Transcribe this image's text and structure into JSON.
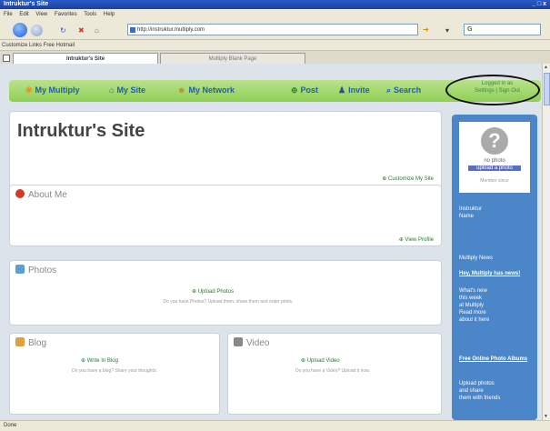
{
  "window": {
    "title": "Intruktur's Site",
    "controls": "_ □ x"
  },
  "menu": {
    "items": [
      "File",
      "Edit",
      "View",
      "Favorites",
      "Tools",
      "Help"
    ]
  },
  "toolbar": {
    "address": "http://instruktur.multiply.com",
    "search_value": "G"
  },
  "links_bar": {
    "text": "Customize Links   Free Hotmail"
  },
  "tabs": [
    {
      "label": "Intruktur's Site"
    },
    {
      "label": "Multiply Blank Page"
    }
  ],
  "global_nav": {
    "items": [
      {
        "label": "My Multiply",
        "icon": "multiply-icon"
      },
      {
        "label": "My Site",
        "icon": "home-icon"
      },
      {
        "label": "My Network",
        "icon": "network-icon"
      },
      {
        "label": "Post",
        "icon": "post-icon"
      },
      {
        "label": "Invite",
        "icon": "invite-icon"
      },
      {
        "label": "Search",
        "icon": "search-icon"
      }
    ],
    "signin_line1": "Logged in as",
    "signin_line2": "Settings | Sign Out"
  },
  "site": {
    "title": "Intruktur's Site",
    "customize_label": "Customize My Site"
  },
  "sections": {
    "about": {
      "title": "About Me",
      "link": "View Profile"
    },
    "photos": {
      "title": "Photos",
      "link": "Upload Photos",
      "hint": "Do you have Photos? Upload them, share them and order prints."
    },
    "blog": {
      "title": "Blog",
      "link": "Write In Blog",
      "hint": "Do you have a blog? Share your thoughts."
    },
    "video": {
      "title": "Video",
      "link": "Upload Video",
      "hint": "Do you have a Video? Upload it now."
    }
  },
  "sidebar": {
    "no_photo": "no photo",
    "upload_photo": "upload a photo",
    "member_since": "Member since",
    "name_lines": [
      "Instruktur",
      "Name"
    ],
    "news_heading": "Multiply News",
    "news1_title": "Hey, Multiply has news!",
    "news1_lines": [
      "What's new",
      "this week",
      "at Multiply",
      "Read more",
      "about it here"
    ],
    "news2_title": "Free Online Photo Albums",
    "news2_lines": [
      "Upload photos",
      "and share",
      "them with friends"
    ]
  },
  "status": {
    "text": "Done"
  }
}
